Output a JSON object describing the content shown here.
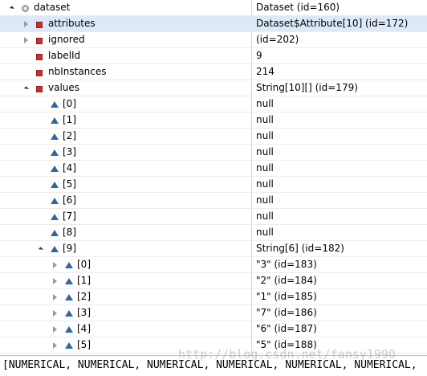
{
  "variables": [
    {
      "name": "dataset",
      "value": "Dataset  (id=160)",
      "icon": "object-circle-icon",
      "expander": "open",
      "level": 0
    },
    {
      "name": "attributes",
      "value": "Dataset$Attribute[10]  (id=172)",
      "icon": "private-field-icon",
      "expander": "closed",
      "level": 1,
      "selected": true
    },
    {
      "name": "ignored",
      "value": " (id=202)",
      "icon": "private-field-icon",
      "expander": "closed",
      "level": 1
    },
    {
      "name": "labelId",
      "value": "9",
      "icon": "private-field-icon",
      "expander": "none",
      "level": 1
    },
    {
      "name": "nbInstances",
      "value": "214",
      "icon": "private-field-icon",
      "expander": "none",
      "level": 1
    },
    {
      "name": "values",
      "value": "String[10][]  (id=179)",
      "icon": "private-field-icon",
      "expander": "open",
      "level": 1
    },
    {
      "name": "[0]",
      "value": "null",
      "icon": "array-element-icon",
      "expander": "none",
      "level": 2
    },
    {
      "name": "[1]",
      "value": "null",
      "icon": "array-element-icon",
      "expander": "none",
      "level": 2
    },
    {
      "name": "[2]",
      "value": "null",
      "icon": "array-element-icon",
      "expander": "none",
      "level": 2
    },
    {
      "name": "[3]",
      "value": "null",
      "icon": "array-element-icon",
      "expander": "none",
      "level": 2
    },
    {
      "name": "[4]",
      "value": "null",
      "icon": "array-element-icon",
      "expander": "none",
      "level": 2
    },
    {
      "name": "[5]",
      "value": "null",
      "icon": "array-element-icon",
      "expander": "none",
      "level": 2
    },
    {
      "name": "[6]",
      "value": "null",
      "icon": "array-element-icon",
      "expander": "none",
      "level": 2
    },
    {
      "name": "[7]",
      "value": "null",
      "icon": "array-element-icon",
      "expander": "none",
      "level": 2
    },
    {
      "name": "[8]",
      "value": "null",
      "icon": "array-element-icon",
      "expander": "none",
      "level": 2
    },
    {
      "name": "[9]",
      "value": "String[6]  (id=182)",
      "icon": "array-element-icon",
      "expander": "open",
      "level": 2
    },
    {
      "name": "[0]",
      "value": "\"3\" (id=183)",
      "icon": "array-element-icon",
      "expander": "closed",
      "level": 3
    },
    {
      "name": "[1]",
      "value": "\"2\" (id=184)",
      "icon": "array-element-icon",
      "expander": "closed",
      "level": 3
    },
    {
      "name": "[2]",
      "value": "\"1\" (id=185)",
      "icon": "array-element-icon",
      "expander": "closed",
      "level": 3
    },
    {
      "name": "[3]",
      "value": "\"7\" (id=186)",
      "icon": "array-element-icon",
      "expander": "closed",
      "level": 3
    },
    {
      "name": "[4]",
      "value": "\"6\" (id=187)",
      "icon": "array-element-icon",
      "expander": "closed",
      "level": 3
    },
    {
      "name": "[5]",
      "value": "\"5\" (id=188)",
      "icon": "array-element-icon",
      "expander": "closed",
      "level": 3
    }
  ],
  "console": {
    "text": "[NUMERICAL, NUMERICAL, NUMERICAL, NUMERICAL, NUMERICAL, NUMERICAL,"
  },
  "watermark": {
    "text": "http://blog.csdn.net/fansy1990"
  },
  "colors": {
    "selected_row": "#dde9f7",
    "field_icon": "#cf2f2f",
    "array_icon": "#2f67a6"
  }
}
